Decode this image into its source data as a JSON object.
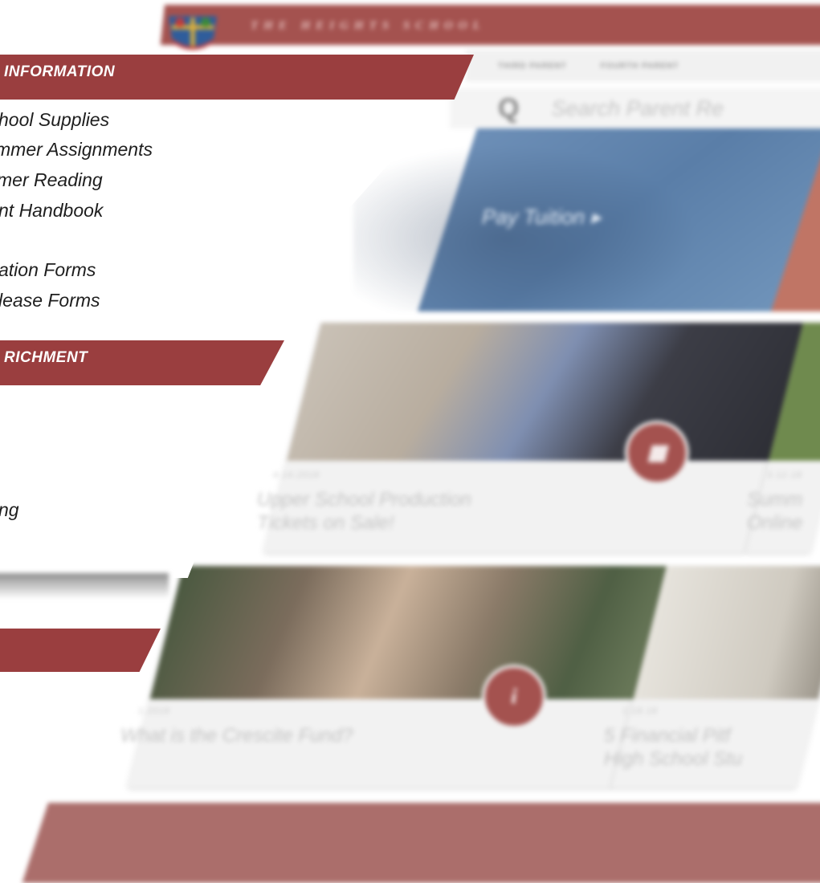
{
  "site": {
    "name": "THE HEIGHTS SCHOOL",
    "nav": [
      "THIRD PARENT",
      "FOURTH PARENT"
    ],
    "search_placeholder": "Search Parent Re"
  },
  "hero": {
    "pay_tuition": "Pay Tuition ▸"
  },
  "cards": [
    {
      "date": "4.14.2018",
      "title_line1": "Upper School Production",
      "title_line2": "Tickets on Sale!"
    },
    {
      "date": "3.12.18",
      "title_line1": "Summ",
      "title_line2": "Online"
    },
    {
      "date": "1.2018",
      "title_line1": "What is the Crescite Fund?",
      "title_line2": ""
    },
    {
      "date": "1.18.18",
      "title_line1": "5 Financial Pitf",
      "title_line2": "High School Stu"
    }
  ],
  "menu": {
    "info_title": "INFORMATION",
    "info_links": [
      "hool Supplies",
      "mmer Assignments",
      "mer Reading",
      "nt Handbook",
      "ation Forms",
      "lease Forms"
    ],
    "enrich_title": "RICHMENT",
    "enrich_links": [
      "ng"
    ]
  },
  "colors": {
    "maroon": "#9a3e3f",
    "header_red": "#a4524f",
    "footer_band": "#ab6e6b",
    "hero_blue": "#5a7ea8"
  },
  "icons": {
    "card1_badge": "calendar-icon",
    "card3_badge": "info-icon",
    "search": "search-icon"
  }
}
